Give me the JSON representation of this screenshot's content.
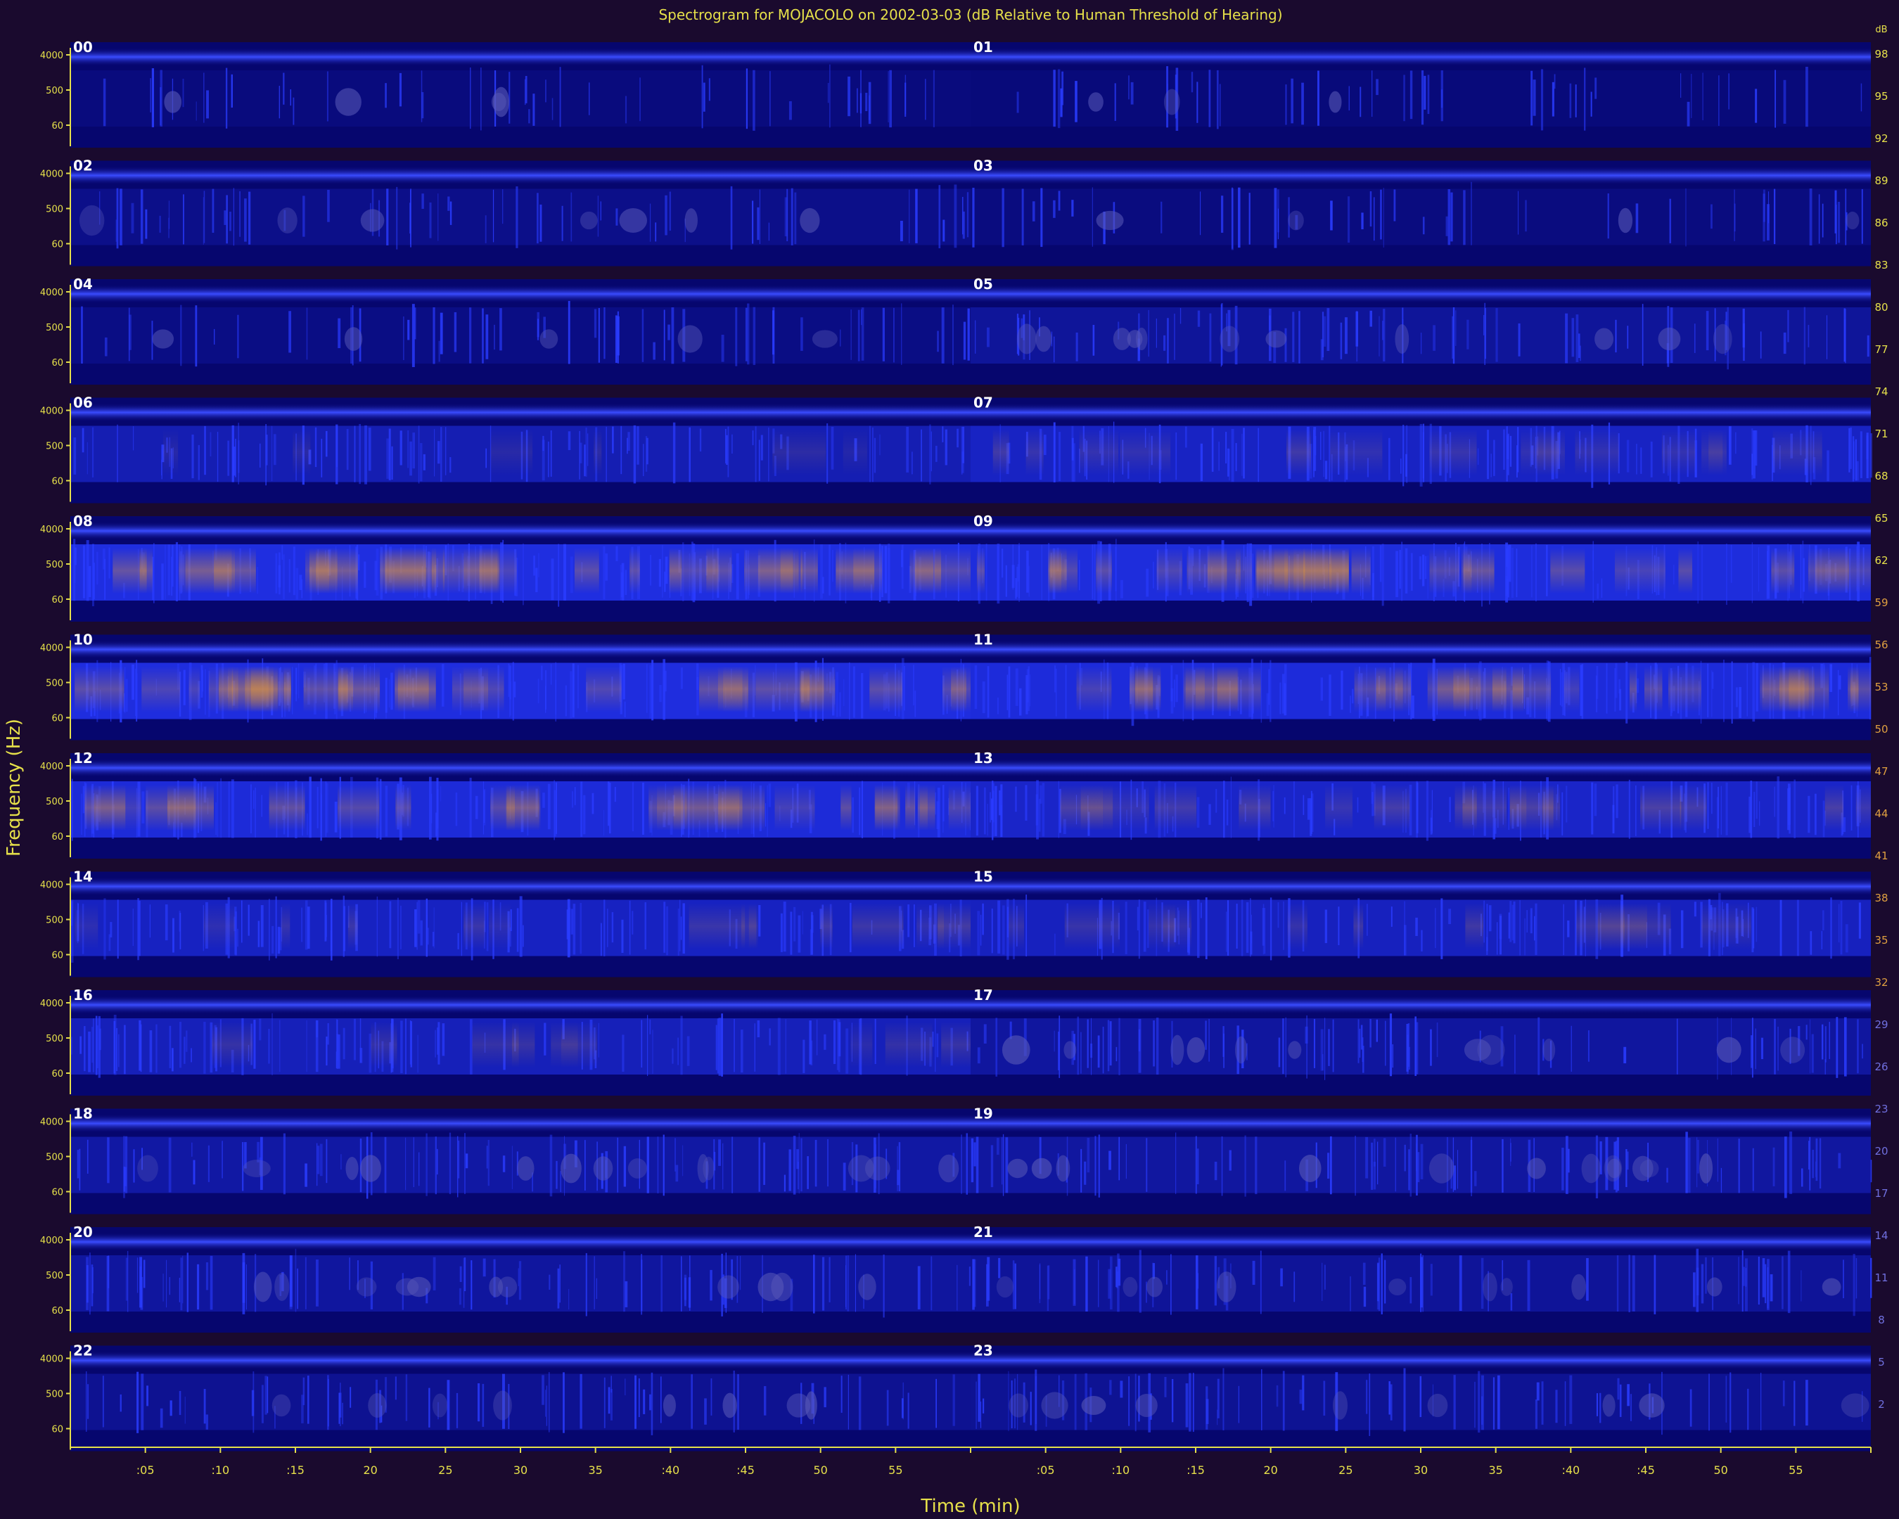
{
  "chart_data": {
    "type": "heatmap",
    "title": "Spectrogram for MOJACOLO on 2002-03-03 (dB Relative to Human Threshold of Hearing)",
    "xlabel": "Time (min)",
    "ylabel": "Frequency (Hz)",
    "row_tick_labels": [
      "4000",
      "500",
      "60"
    ],
    "x_tick_labels": [
      ":05",
      ":10",
      ":15",
      "20",
      "25",
      "30",
      "35",
      ":40",
      ":45",
      "50",
      "55",
      "",
      ":05",
      ":10",
      ":15",
      "20",
      "25",
      "30",
      "35",
      ":40",
      ":45",
      "50",
      "55",
      ""
    ],
    "hour_labels": [
      "00",
      "01",
      "02",
      "03",
      "04",
      "05",
      "06",
      "07",
      "08",
      "09",
      "10",
      "11",
      "12",
      "13",
      "14",
      "15",
      "16",
      "17",
      "18",
      "19",
      "20",
      "21",
      "22",
      "23"
    ],
    "colorbar": {
      "labels": [
        "98",
        "95",
        "92",
        "89",
        "86",
        "83",
        "80",
        "77",
        "74",
        "71",
        "68",
        "65",
        "62",
        "59",
        "56",
        "53",
        "50",
        "47",
        "44",
        "41",
        "38",
        "35",
        "32",
        "29",
        "26",
        "23",
        "20",
        "17",
        "14",
        "11",
        "8",
        "5",
        "2"
      ],
      "unit": "dB"
    },
    "activity": [
      0.12,
      0.1,
      0.22,
      0.14,
      0.18,
      0.35,
      0.55,
      0.68,
      0.92,
      0.88,
      0.9,
      0.86,
      0.85,
      0.72,
      0.66,
      0.64,
      0.6,
      0.38,
      0.42,
      0.4,
      0.38,
      0.34,
      0.28,
      0.3
    ],
    "colors": {
      "background": "#1a0a2e",
      "low": "#06066e",
      "mid": "#1f2ee0",
      "high": "#d08a30",
      "axis": "#e6e04a"
    }
  }
}
